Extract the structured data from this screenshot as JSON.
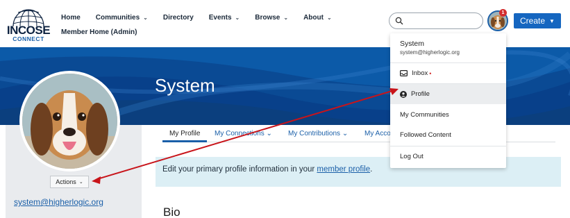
{
  "logo": {
    "main": "INCOSE",
    "sub": "CONNECT"
  },
  "nav": {
    "items": [
      {
        "label": "Home",
        "has_menu": false
      },
      {
        "label": "Communities",
        "has_menu": true
      },
      {
        "label": "Directory",
        "has_menu": false
      },
      {
        "label": "Events",
        "has_menu": true
      },
      {
        "label": "Browse",
        "has_menu": true
      },
      {
        "label": "About",
        "has_menu": true
      }
    ],
    "member_home": "Member Home (Admin)"
  },
  "search": {
    "placeholder": "",
    "icon": "search-icon"
  },
  "user_menu": {
    "badge_count": "1"
  },
  "create_button": {
    "label": "Create"
  },
  "banner": {
    "title": "System"
  },
  "profile": {
    "actions_label": "Actions",
    "email": "system@higherlogic.org"
  },
  "tabs": {
    "items": [
      {
        "label": "My Profile",
        "active": true,
        "has_menu": false
      },
      {
        "label": "My Connections",
        "active": false,
        "has_menu": true
      },
      {
        "label": "My Contributions",
        "active": false,
        "has_menu": true
      },
      {
        "label": "My Acco",
        "active": false,
        "has_menu": false
      }
    ]
  },
  "info": {
    "text_before": "Edit your primary profile information in your ",
    "link": "member profile",
    "text_after": "."
  },
  "bio": {
    "heading": "Bio"
  },
  "dropdown": {
    "name": "System",
    "email": "system@higherlogic.org",
    "items": [
      {
        "label": "Inbox",
        "icon": "inbox-icon",
        "dot": "•"
      },
      {
        "label": "Profile",
        "icon": "user-circle-icon"
      },
      {
        "label": "My Communities"
      },
      {
        "label": "Followed Content"
      },
      {
        "label": "Log Out"
      }
    ]
  },
  "colors": {
    "primary": "#1566c0",
    "link": "#1a5fa8",
    "banner": "#0d4f9a",
    "arrow": "#c8141a",
    "info_bg": "#dceff5"
  }
}
